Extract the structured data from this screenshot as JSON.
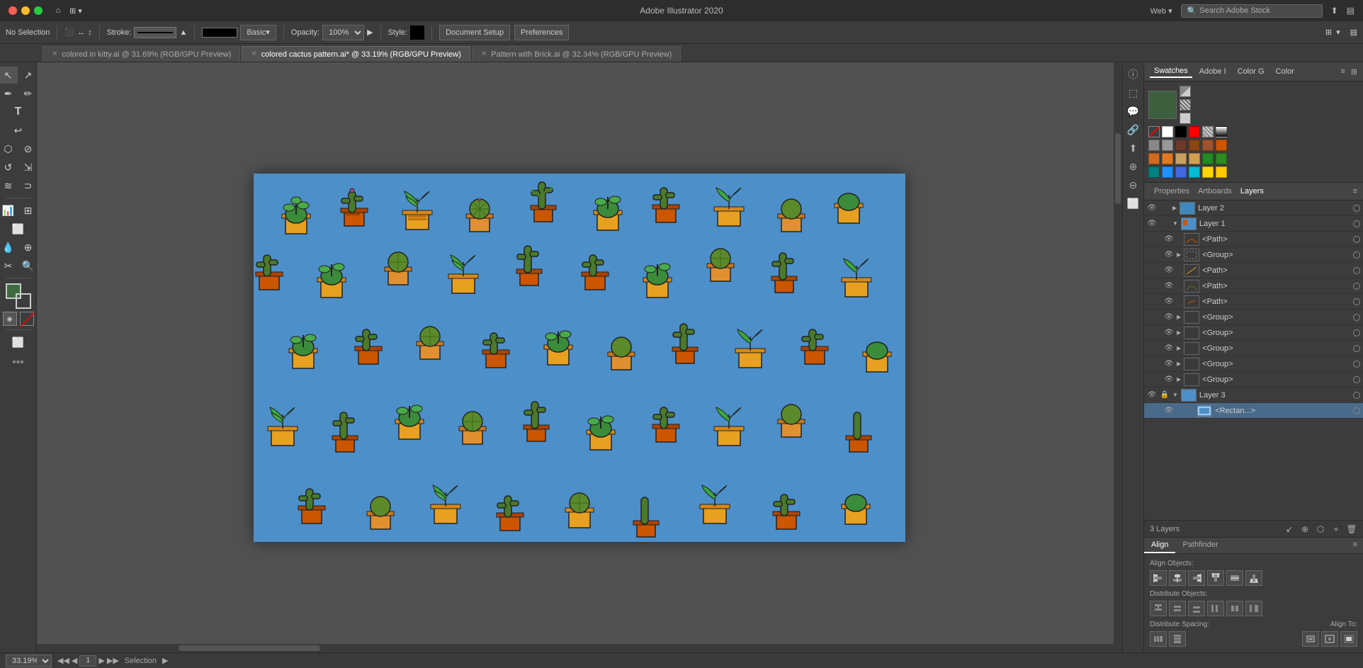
{
  "app": {
    "title": "Adobe Illustrator 2020",
    "window_controls": [
      "close",
      "minimize",
      "maximize"
    ],
    "home_icon": "⌂",
    "grid_icon": "⊞",
    "web_label": "Web",
    "search_stock_placeholder": "Search Adobe Stock"
  },
  "toolbar": {
    "selection_label": "No Selection",
    "stroke_label": "Stroke:",
    "stroke_value": "",
    "basic_label": "Basic",
    "opacity_label": "Opacity:",
    "opacity_value": "100%",
    "style_label": "Style:",
    "document_setup": "Document Setup",
    "preferences": "Preferences"
  },
  "tabs": [
    {
      "id": "tab1",
      "label": "colored in kitty.ai @ 31.69% (RGB/GPU Preview)",
      "active": false,
      "modified": false
    },
    {
      "id": "tab2",
      "label": "colored cactus pattern.ai* @ 33.19% (RGB/GPU Preview)",
      "active": true,
      "modified": true
    },
    {
      "id": "tab3",
      "label": "Pattern with Brick.ai @ 32.34% (RGB/GPU Preview)",
      "active": false,
      "modified": false
    }
  ],
  "swatches_panel": {
    "tabs": [
      "Swatches",
      "Adobe I",
      "Color G",
      "Color"
    ],
    "active_tab": "Swatches",
    "color_rows": [
      [
        "none",
        "white",
        "black",
        "red",
        "pattern1",
        "gradient1"
      ],
      [
        "gray1",
        "gray2",
        "brown1",
        "brown2",
        "brown3",
        "orange1"
      ],
      [
        "orange2",
        "orange3",
        "tan1",
        "tan2",
        "green1",
        "green2"
      ],
      [
        "teal1",
        "blue1",
        "blue2",
        "cyan1",
        "yellow1",
        "yellow2"
      ]
    ],
    "swatch_colors": {
      "none": "none",
      "white": "#ffffff",
      "black": "#000000",
      "red": "#ff0000",
      "gray1": "#888888",
      "gray2": "#999999",
      "brown1": "#6b3a2a",
      "brown2": "#8b4513",
      "brown3": "#a0522d",
      "orange1": "#cc5500",
      "orange2": "#d2691e",
      "orange3": "#e07820",
      "tan1": "#c8a060",
      "tan2": "#d4a050",
      "green1": "#228b22",
      "green2": "#2d8b22",
      "teal1": "#008080",
      "blue1": "#1e90ff",
      "blue2": "#4169e1",
      "cyan1": "#00bcd4",
      "yellow1": "#ffd700",
      "yellow2": "#ffcc00"
    }
  },
  "layers_panel": {
    "panel_tabs": [
      "Properties",
      "Artboards",
      "Layers"
    ],
    "active_tab": "Layers",
    "layers_count": "3 Layers",
    "layers": [
      {
        "name": "Layer 2",
        "visible": true,
        "locked": false,
        "expanded": false,
        "selected": false,
        "color": "#3399ff",
        "children": []
      },
      {
        "name": "Layer 1",
        "visible": true,
        "locked": false,
        "expanded": true,
        "selected": false,
        "color": "#ff9900",
        "children": [
          {
            "name": "<Path>",
            "visible": true,
            "locked": false
          },
          {
            "name": "<Group>",
            "visible": true,
            "locked": false,
            "expanded": false
          },
          {
            "name": "<Path>",
            "visible": true,
            "locked": false
          },
          {
            "name": "<Path>",
            "visible": true,
            "locked": false
          },
          {
            "name": "<Path>",
            "visible": true,
            "locked": false
          },
          {
            "name": "<Group>",
            "visible": true,
            "locked": false,
            "expanded": false
          },
          {
            "name": "<Group>",
            "visible": true,
            "locked": false,
            "expanded": false
          },
          {
            "name": "<Group>",
            "visible": true,
            "locked": false,
            "expanded": false
          },
          {
            "name": "<Group>",
            "visible": true,
            "locked": false,
            "expanded": false
          },
          {
            "name": "<Group>",
            "visible": true,
            "locked": false,
            "expanded": false
          },
          {
            "name": "<Group>",
            "visible": true,
            "locked": false,
            "expanded": false
          }
        ]
      },
      {
        "name": "Layer 3",
        "visible": true,
        "locked": true,
        "expanded": true,
        "selected": false,
        "color": "#33cc33",
        "children": [
          {
            "name": "<Rectan...",
            "visible": true,
            "locked": false
          }
        ]
      }
    ],
    "bottom_buttons": [
      "make-sublayer",
      "expand-collapse",
      "locate",
      "new-layer",
      "delete-layer"
    ]
  },
  "align_panel": {
    "tabs": [
      "Align",
      "Pathfinder"
    ],
    "active_tab": "Align",
    "align_objects_label": "Align Objects:",
    "distribute_objects_label": "Distribute Objects:",
    "distribute_spacing_label": "Distribute Spacing:",
    "align_to_label": "Align To:",
    "align_buttons": [
      "align-left",
      "align-center-h",
      "align-right",
      "align-top",
      "align-center-v",
      "align-bottom"
    ],
    "distribute_buttons": [
      "dist-left",
      "dist-center-h",
      "dist-right",
      "dist-top",
      "dist-center-v",
      "dist-bottom"
    ]
  },
  "status_bar": {
    "zoom": "33.19%",
    "artboard_nav": "1",
    "tool_label": "Selection"
  },
  "canvas": {
    "background_color": "#4d8fc9",
    "artboard_label": "colored cactus pattern"
  }
}
